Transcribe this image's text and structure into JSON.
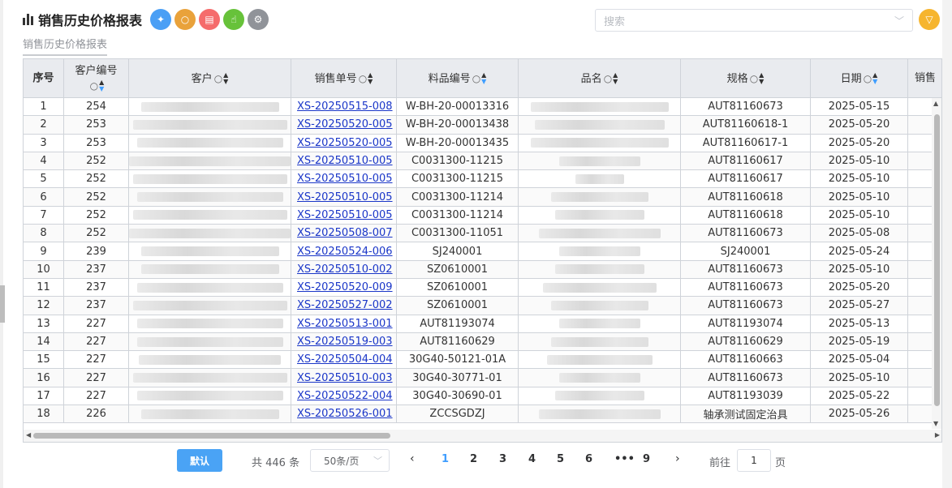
{
  "header": {
    "title": "销售历史价格报表",
    "toolbar_icons": [
      {
        "name": "pin-icon",
        "glyph": "✦",
        "color": "#4a9ff5"
      },
      {
        "name": "search-icon",
        "glyph": "○",
        "color": "#e9a23b"
      },
      {
        "name": "document-icon",
        "glyph": "▤",
        "color": "#f56c6c"
      },
      {
        "name": "hand-icon",
        "glyph": "☝",
        "color": "#67c23a"
      },
      {
        "name": "settings-icon",
        "glyph": "⚙",
        "color": "#909399"
      }
    ],
    "search_placeholder": "搜索",
    "filter_color": "#f6b52f"
  },
  "subtab": "销售历史价格报表",
  "table": {
    "columns": [
      {
        "label": "序号",
        "bold": true,
        "search": false,
        "sort": false
      },
      {
        "label": "客户编号",
        "bold": false,
        "search": true,
        "sort": true,
        "sort_active": "down"
      },
      {
        "label": "客户",
        "bold": false,
        "search": true,
        "sort": true
      },
      {
        "label": "销售单号",
        "bold": false,
        "search": true,
        "sort": true
      },
      {
        "label": "料品编号",
        "bold": false,
        "search": true,
        "sort": true,
        "sort_active": "down"
      },
      {
        "label": "品名",
        "bold": false,
        "search": true,
        "sort": true
      },
      {
        "label": "规格",
        "bold": false,
        "search": true,
        "sort": true
      },
      {
        "label": "日期",
        "bold": false,
        "search": true,
        "sort": true,
        "sort_active": "down"
      },
      {
        "label": "销售",
        "bold": false,
        "search": false,
        "sort": false
      }
    ],
    "rows": [
      [
        "1",
        "254",
        "XS-20250515-008",
        "W-BH-20-00013316",
        "AUT81160673",
        "2025-05-15"
      ],
      [
        "2",
        "253",
        "XS-20250520-005",
        "W-BH-20-00013438",
        "AUT81160618-1",
        "2025-05-20"
      ],
      [
        "3",
        "253",
        "XS-20250520-005",
        "W-BH-20-00013435",
        "AUT81160617-1",
        "2025-05-20"
      ],
      [
        "4",
        "252",
        "XS-20250510-005",
        "C0031300-11215",
        "AUT81160617",
        "2025-05-10"
      ],
      [
        "5",
        "252",
        "XS-20250510-005",
        "C0031300-11215",
        "AUT81160617",
        "2025-05-10"
      ],
      [
        "6",
        "252",
        "XS-20250510-005",
        "C0031300-11214",
        "AUT81160618",
        "2025-05-10"
      ],
      [
        "7",
        "252",
        "XS-20250510-005",
        "C0031300-11214",
        "AUT81160618",
        "2025-05-10"
      ],
      [
        "8",
        "252",
        "XS-20250508-007",
        "C0031300-11051",
        "AUT81160673",
        "2025-05-08"
      ],
      [
        "9",
        "239",
        "XS-20250524-006",
        "SJ240001",
        "SJ240001",
        "2025-05-24"
      ],
      [
        "10",
        "237",
        "XS-20250510-002",
        "SZ0610001",
        "AUT81160673",
        "2025-05-10"
      ],
      [
        "11",
        "237",
        "XS-20250520-009",
        "SZ0610001",
        "AUT81160673",
        "2025-05-20"
      ],
      [
        "12",
        "237",
        "XS-20250527-002",
        "SZ0610001",
        "AUT81160673",
        "2025-05-27"
      ],
      [
        "13",
        "227",
        "XS-20250513-001",
        "AUT81193074",
        "AUT81193074",
        "2025-05-13"
      ],
      [
        "14",
        "227",
        "XS-20250519-003",
        "AUT81160629",
        "AUT81160629",
        "2025-05-19"
      ],
      [
        "15",
        "227",
        "XS-20250504-004",
        "30G40-50121-01A",
        "AUT81160663",
        "2025-05-04"
      ],
      [
        "16",
        "227",
        "XS-20250510-003",
        "30G40-30771-01",
        "AUT81160673",
        "2025-05-10"
      ],
      [
        "17",
        "227",
        "XS-20250522-004",
        "30G40-30690-01",
        "AUT81193039",
        "2025-05-22"
      ],
      [
        "18",
        "226",
        "XS-20250526-001",
        "ZCCSGDZJ",
        "轴承测试固定治具",
        "2025-05-26"
      ]
    ]
  },
  "pager": {
    "default_label": "默认",
    "total": "共 446 条",
    "page_size": "50条/页",
    "prev": "‹",
    "next": "›",
    "pages": [
      "1",
      "2",
      "3",
      "4",
      "5",
      "6",
      "•••",
      "9"
    ],
    "active_page": "1",
    "goto_label": "前往",
    "goto_value": "1",
    "page_suffix": "页"
  }
}
